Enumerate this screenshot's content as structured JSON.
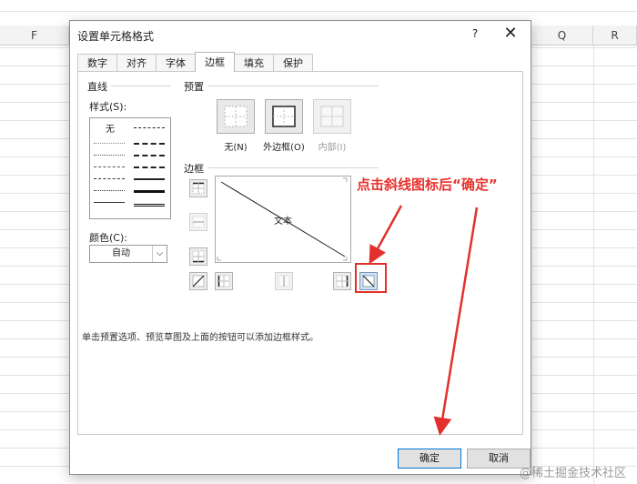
{
  "sheet": {
    "columns": [
      "F",
      "Q",
      "R"
    ]
  },
  "dialog": {
    "title": "设置单元格格式",
    "help": "?",
    "close": "✕",
    "tabs": [
      "数字",
      "对齐",
      "字体",
      "边框",
      "填充",
      "保护"
    ],
    "active_tab": "边框",
    "line_group": "直线",
    "style_label": "样式(S):",
    "style_none": "无",
    "color_label": "颜色(C):",
    "color_value": "自动",
    "presets_group": "预置",
    "presets": {
      "none": "无(N)",
      "outline": "外边框(O)",
      "inside": "内部(I)"
    },
    "border_group": "边框",
    "preview_text": "文本",
    "hint": "单击预置选项、预览草图及上面的按钮可以添加边框样式。",
    "ok": "确定",
    "cancel": "取消"
  },
  "annotation": {
    "text": "点击斜线图标后“确定”",
    "color": "#e8312c"
  },
  "watermark": "@稀土掘金技术社区"
}
